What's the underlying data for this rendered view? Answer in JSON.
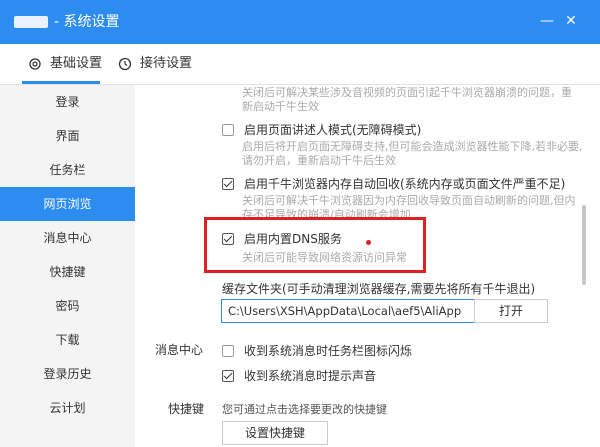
{
  "window": {
    "title": "- 系统设置",
    "close_glyph": "✕",
    "min_glyph": "—"
  },
  "tabs": [
    {
      "label": "基础设置",
      "icon": "gear-icon"
    },
    {
      "label": "接待设置",
      "icon": "clock-icon"
    }
  ],
  "sidebar": {
    "items": [
      "登录",
      "界面",
      "任务栏",
      "网页浏览",
      "消息中心",
      "快捷键",
      "密码",
      "下载",
      "登录历史",
      "云计划"
    ],
    "active": "网页浏览"
  },
  "content": {
    "top_desc_1": "关闭后可解决某些涉及音视频的页面引起千牛浏览器崩溃的问题，重",
    "top_desc_2": "新启动千牛生效",
    "narrator": {
      "label": "启用页面讲述人模式(无障碍模式)",
      "checked": false,
      "desc_1": "启用后将开启页面无障碍支持,但可能会造成浏览器性能下降,若非必要,",
      "desc_2": "请勿开启，重新启动千牛后生效"
    },
    "memory": {
      "label": "启用千牛浏览器内存自动回收(系统内存或页面文件严重不足)",
      "checked": true,
      "desc_1": "关闭后可解决千牛浏览器因为内存回收导致页面自动刷新的问题,但内",
      "desc_2": "存不足导致的崩溃/自动刷新会增加"
    },
    "dns": {
      "label": "启用内置DNS服务",
      "checked": true,
      "desc": "关闭后可能导致网络资源访问异常"
    },
    "cache": {
      "label": "缓存文件夹(可手动清理浏览器缓存,需要先将所有千牛退出)",
      "path": "C:\\Users\\XSH\\AppData\\Local\\aef5\\AliApp",
      "open_button": "打开"
    },
    "message_center": {
      "label": "消息中心",
      "opt1": {
        "label": "收到系统消息时任务栏图标闪烁",
        "checked": false
      },
      "opt2": {
        "label": "收到系统消息时提示声音",
        "checked": true
      }
    },
    "shortcut": {
      "label": "快捷键",
      "desc": "您可通过点击选择要更改的快捷键",
      "button": "设置快捷键"
    }
  },
  "colors": {
    "accent": "#2d8cf0",
    "highlight": "#e02020"
  }
}
